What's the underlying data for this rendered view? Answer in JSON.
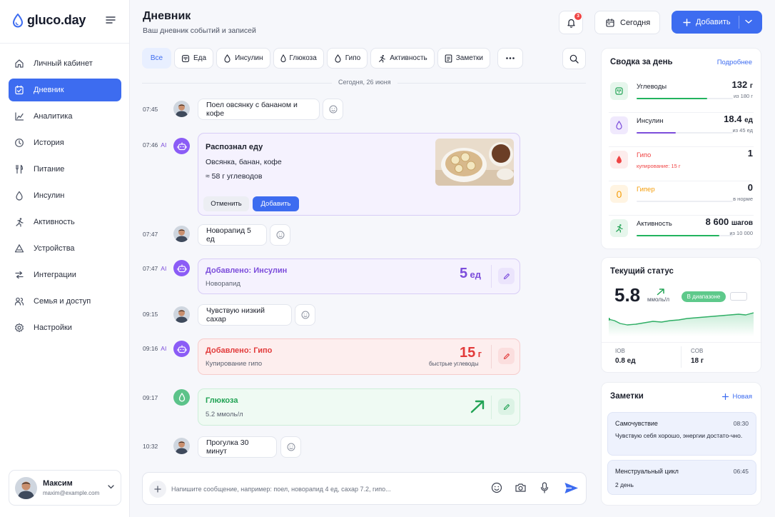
{
  "app": {
    "name": "gluco.day"
  },
  "nav": [
    {
      "label": "Личный кабинет",
      "icon": "home-icon"
    },
    {
      "label": "Дневник",
      "icon": "diary-icon",
      "active": true
    },
    {
      "label": "Аналитика",
      "icon": "analytics-icon"
    },
    {
      "label": "История",
      "icon": "history-icon"
    },
    {
      "label": "Питание",
      "icon": "food-icon"
    },
    {
      "label": "Инсулин",
      "icon": "drop-icon"
    },
    {
      "label": "Активность",
      "icon": "activity-icon"
    },
    {
      "label": "Устройства",
      "icon": "devices-icon"
    },
    {
      "label": "Интеграции",
      "icon": "integrations-icon"
    },
    {
      "label": "Семья и доступ",
      "icon": "family-icon"
    },
    {
      "label": "Настройки",
      "icon": "settings-icon"
    }
  ],
  "user": {
    "name": "Максим",
    "email": "maxim@example.com"
  },
  "header": {
    "title": "Дневник",
    "subtitle": "Ваш дневник событий и записей",
    "notifications": "3",
    "today": "Сегодня",
    "add": "Добавить"
  },
  "filters": [
    "Все",
    "Еда",
    "Инсулин",
    "Глюкоза",
    "Гипо",
    "Активность",
    "Заметки"
  ],
  "feed": {
    "date": "Сегодня, 26 июня",
    "ai_tag": "AI",
    "msg1": {
      "time": "07:45",
      "text": "Поел овсянку с бананом и кофе"
    },
    "ai1": {
      "time": "07:46",
      "title": "Распознал еду",
      "line1": "Овсянка, банан, кофе",
      "line2": "≈ 58 г углеводов",
      "cancel": "Отменить",
      "add": "Добавить"
    },
    "msg2": {
      "time": "07:47",
      "text": "Новорапид 5 ед"
    },
    "insulin": {
      "time": "07:47",
      "title": "Добавлено: Инсулин",
      "sub": "Новорапид",
      "value": "5",
      "unit": "ед"
    },
    "msg3": {
      "time": "09:15",
      "text": "Чувствую низкий сахар"
    },
    "hypo": {
      "time": "09:16",
      "title": "Добавлено: Гипо",
      "sub": "Купирование гипо",
      "value": "15",
      "unit": "г",
      "note": "быстрые углеводы"
    },
    "glucose": {
      "time": "09:17",
      "title": "Глюкоза",
      "sub": "5.2 ммоль/л"
    },
    "msg4": {
      "time": "10:32",
      "text": "Прогулка 30 минут"
    }
  },
  "composer": {
    "placeholder": "Напишите сообщение, например: поел, новорапид 4 ед, сахар 7.2, гипо..."
  },
  "summary": {
    "title": "Сводка за день",
    "link": "Подробнее",
    "carbs": {
      "label": "Углеводы",
      "value": "132",
      "unit": "г",
      "of": "из 180 г",
      "progress": 0.73,
      "color": "#22b35e"
    },
    "insulin": {
      "label": "Инсулин",
      "value": "18.4",
      "unit": "ед",
      "of": "из 45 ед",
      "progress": 0.41,
      "color": "#7c4ddb"
    },
    "hypo": {
      "label": "Гипо",
      "value": "1",
      "sub": "купирование: 15 г",
      "color": "#ef4444"
    },
    "hyper": {
      "label": "Гипер",
      "value": "0",
      "of": "в норме",
      "color": "#f59e0b"
    },
    "activity": {
      "label": "Активность",
      "value": "8 600",
      "unit": "шагов",
      "of": "из 10 000",
      "progress": 0.86,
      "color": "#22b35e"
    }
  },
  "status": {
    "title": "Текущий статус",
    "value": "5.8",
    "unit": "ммоль/л",
    "badge": "В диапазоне",
    "iob_label": "IOB",
    "iob": "0.8 ед",
    "cob_label": "COB",
    "cob": "18 г"
  },
  "notes": {
    "title": "Заметки",
    "new": "Новая",
    "items": [
      {
        "title": "Самочувствие",
        "time": "08:30",
        "text": "Чувствую себя хорошо, энергии достато-чно."
      },
      {
        "title": "Менструальный цикл",
        "time": "06:45",
        "text": "2 день"
      }
    ]
  }
}
